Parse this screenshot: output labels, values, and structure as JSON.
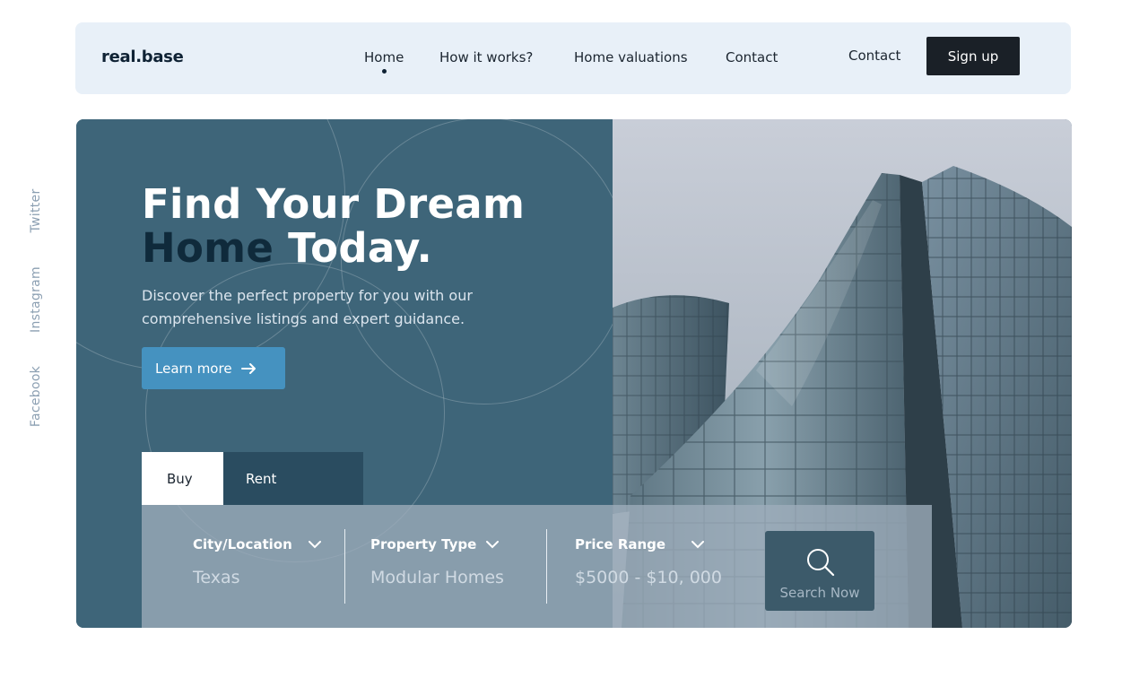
{
  "brand": {
    "logo": "real.base"
  },
  "nav": {
    "items": [
      {
        "label": "Home",
        "active": true
      },
      {
        "label": "How it works?"
      },
      {
        "label": "Home valuations"
      },
      {
        "label": "Contact"
      }
    ],
    "contact": "Contact",
    "signup": "Sign up"
  },
  "social": [
    "Twitter",
    "Instagram",
    "Facebook"
  ],
  "hero": {
    "headline_line1": "Find Your Dream",
    "headline_accent": "Home",
    "headline_rest": "Today.",
    "subtext": "Discover the perfect property for you with our comprehensive listings and expert guidance.",
    "cta": "Learn more"
  },
  "search": {
    "tabs": [
      {
        "label": "Buy",
        "active": true
      },
      {
        "label": "Rent"
      }
    ],
    "fields": [
      {
        "label": "City/Location",
        "value": "Texas"
      },
      {
        "label": "Property Type",
        "value": "Modular Homes"
      },
      {
        "label": "Price Range",
        "value": "$5000 - $10, 000"
      }
    ],
    "button": "Search Now"
  },
  "colors": {
    "hero_bg": "#3e6579",
    "accent_button": "#4592c0",
    "topbar_bg": "#e8f0f8",
    "signup_bg": "#1a2027"
  }
}
